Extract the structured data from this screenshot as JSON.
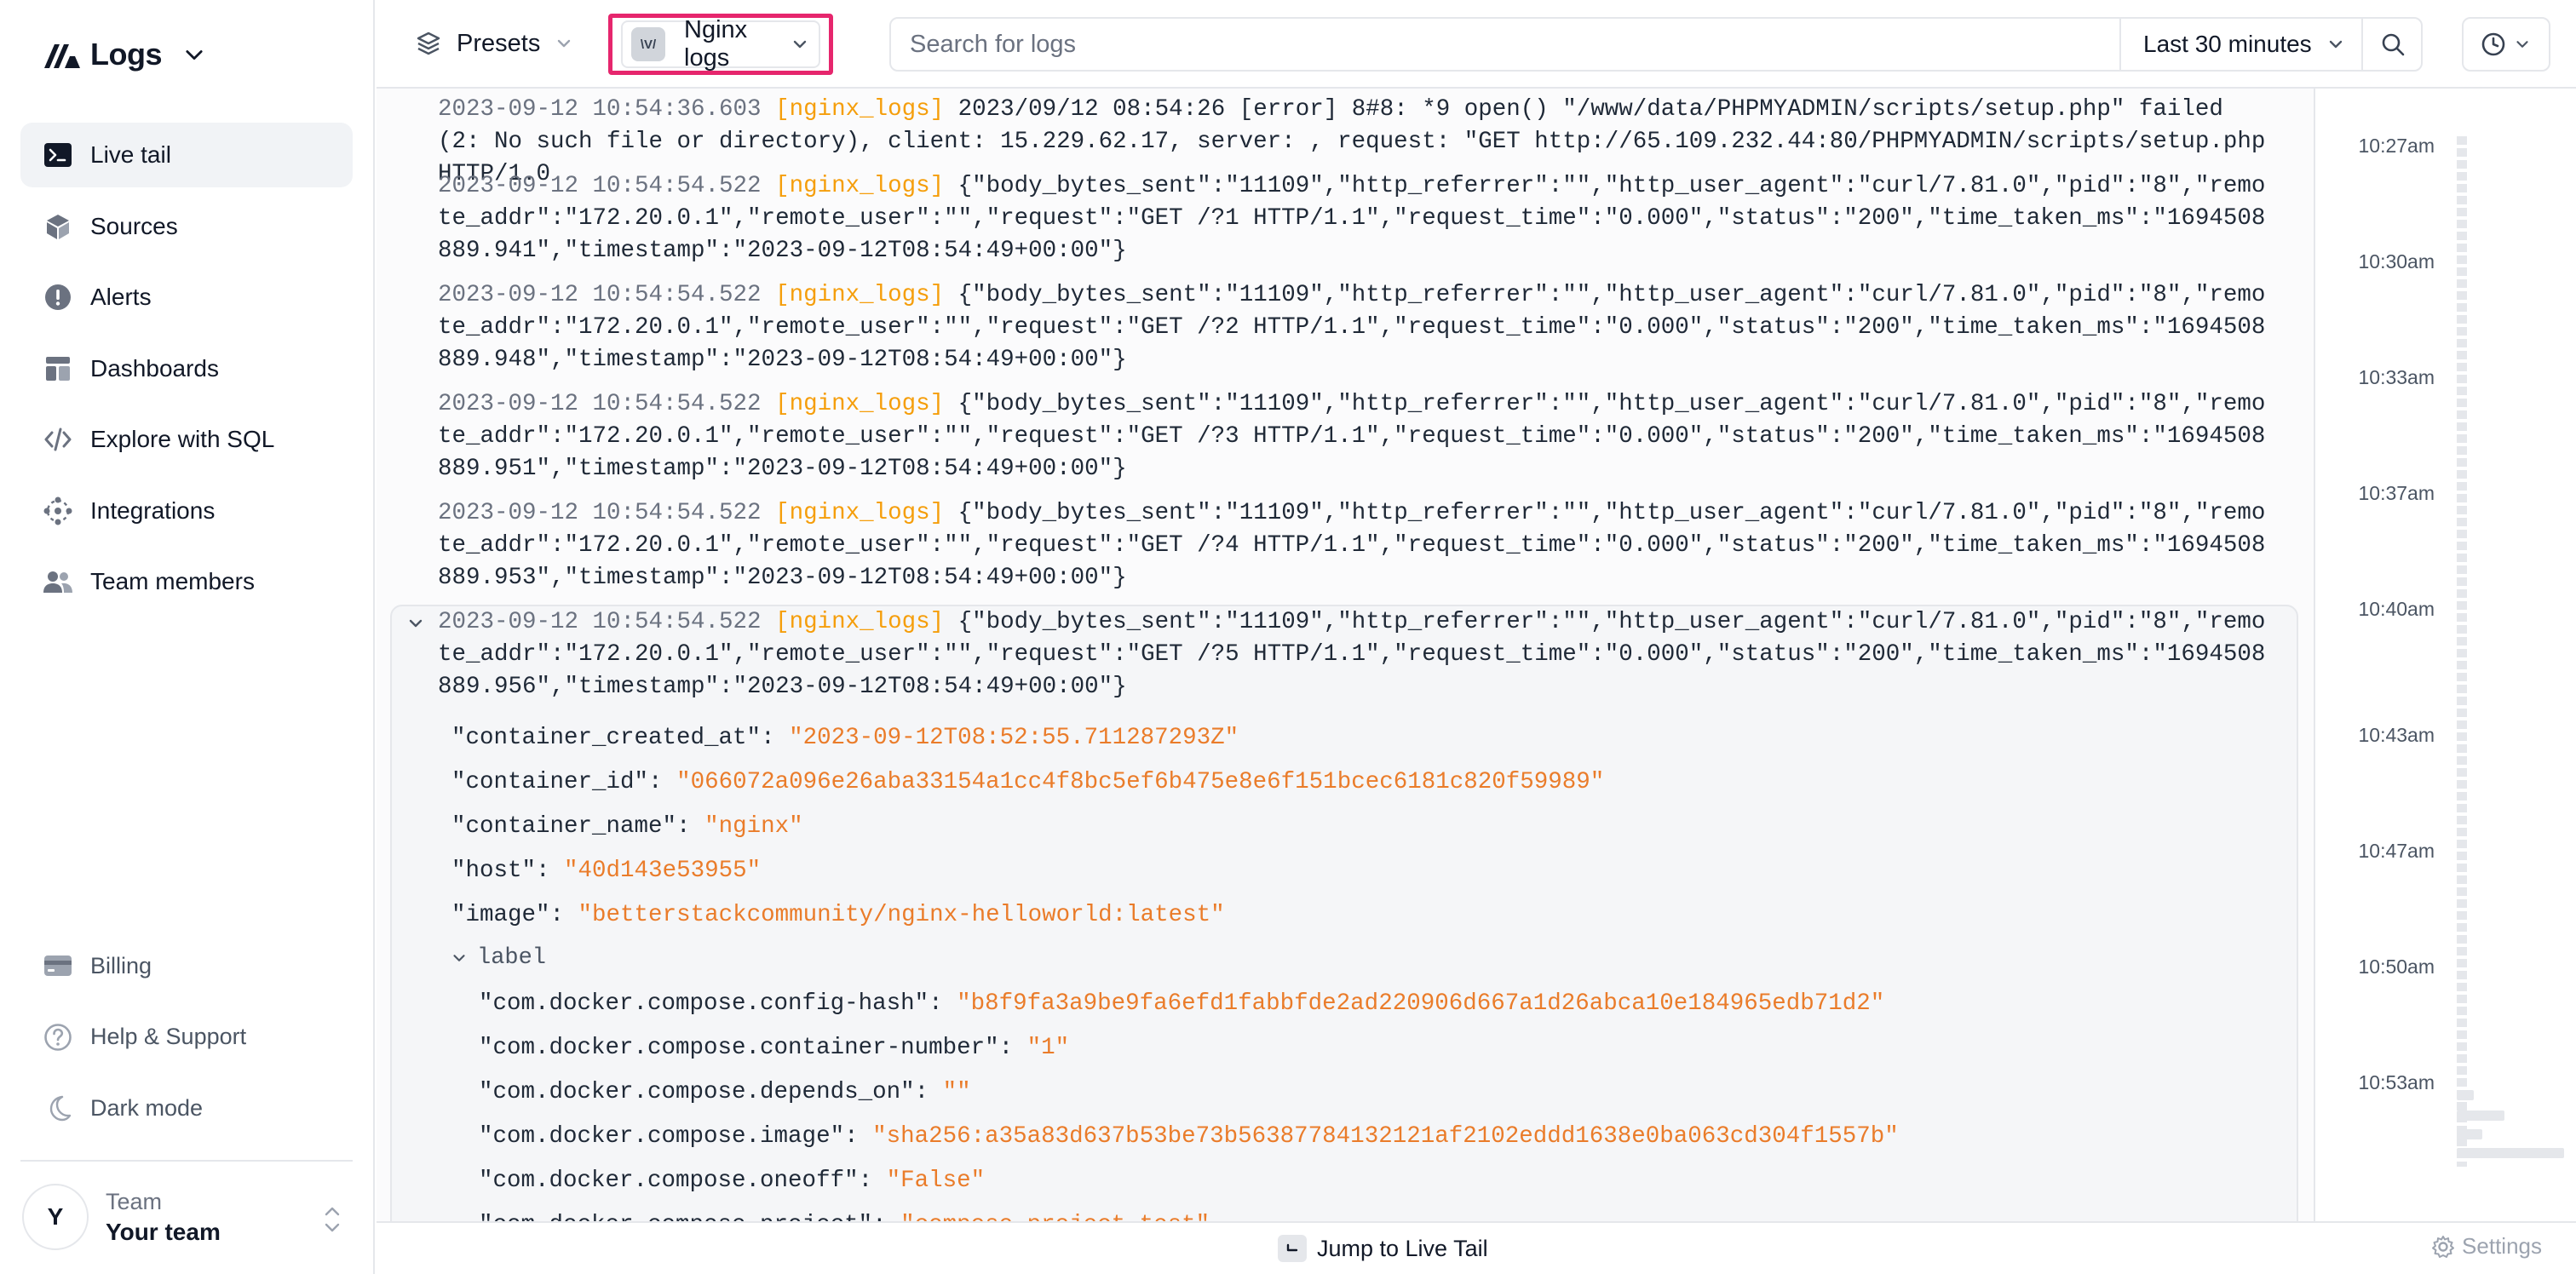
{
  "app": {
    "name": "Logs"
  },
  "sidebar": {
    "items": [
      {
        "label": "Live tail",
        "icon": "terminal-icon",
        "active": true
      },
      {
        "label": "Sources",
        "icon": "cube-icon"
      },
      {
        "label": "Alerts",
        "icon": "alert-icon"
      },
      {
        "label": "Dashboards",
        "icon": "dashboard-icon"
      },
      {
        "label": "Explore with SQL",
        "icon": "code-icon"
      },
      {
        "label": "Integrations",
        "icon": "integrations-icon"
      },
      {
        "label": "Team members",
        "icon": "users-icon"
      }
    ],
    "bottom_items": [
      {
        "label": "Billing",
        "icon": "card-icon"
      },
      {
        "label": "Help & Support",
        "icon": "help-icon"
      },
      {
        "label": "Dark mode",
        "icon": "moon-icon"
      }
    ],
    "team": {
      "avatar": "Y",
      "label": "Team",
      "name": "Your team"
    }
  },
  "toolbar": {
    "presets_label": "Presets",
    "source_badge": "\\V/",
    "source_label": "Nginx logs",
    "search_placeholder": "Search for logs",
    "time_range": "Last 30 minutes"
  },
  "colors": {
    "accent": "#e6266d",
    "source_tag": "#f59e0b",
    "value": "#ea7c2a"
  },
  "logs": [
    {
      "ts": "2023-09-12 10:54:36.603",
      "source": "[nginx_logs]",
      "msg": "2023/09/12 08:54:26 [error] 8#8: *9 open() \"/www/data/PHPMYADMIN/scripts/setup.php\" failed (2: No such file or directory), client: 15.229.62.17, server: , request: \"GET http://65.109.232.44:80/PHPMYADMIN/scripts/setup.php HTTP/1.0"
    },
    {
      "ts": "2023-09-12 10:54:54.522",
      "source": "[nginx_logs]",
      "msg": "{\"body_bytes_sent\":\"11109\",\"http_referrer\":\"\",\"http_user_agent\":\"curl/7.81.0\",\"pid\":\"8\",\"remote_addr\":\"172.20.0.1\",\"remote_user\":\"\",\"request\":\"GET /?1 HTTP/1.1\",\"request_time\":\"0.000\",\"status\":\"200\",\"time_taken_ms\":\"1694508889.941\",\"timestamp\":\"2023-09-12T08:54:49+00:00\"}"
    },
    {
      "ts": "2023-09-12 10:54:54.522",
      "source": "[nginx_logs]",
      "msg": "{\"body_bytes_sent\":\"11109\",\"http_referrer\":\"\",\"http_user_agent\":\"curl/7.81.0\",\"pid\":\"8\",\"remote_addr\":\"172.20.0.1\",\"remote_user\":\"\",\"request\":\"GET /?2 HTTP/1.1\",\"request_time\":\"0.000\",\"status\":\"200\",\"time_taken_ms\":\"1694508889.948\",\"timestamp\":\"2023-09-12T08:54:49+00:00\"}"
    },
    {
      "ts": "2023-09-12 10:54:54.522",
      "source": "[nginx_logs]",
      "msg": "{\"body_bytes_sent\":\"11109\",\"http_referrer\":\"\",\"http_user_agent\":\"curl/7.81.0\",\"pid\":\"8\",\"remote_addr\":\"172.20.0.1\",\"remote_user\":\"\",\"request\":\"GET /?3 HTTP/1.1\",\"request_time\":\"0.000\",\"status\":\"200\",\"time_taken_ms\":\"1694508889.951\",\"timestamp\":\"2023-09-12T08:54:49+00:00\"}"
    },
    {
      "ts": "2023-09-12 10:54:54.522",
      "source": "[nginx_logs]",
      "msg": "{\"body_bytes_sent\":\"11109\",\"http_referrer\":\"\",\"http_user_agent\":\"curl/7.81.0\",\"pid\":\"8\",\"remote_addr\":\"172.20.0.1\",\"remote_user\":\"\",\"request\":\"GET /?4 HTTP/1.1\",\"request_time\":\"0.000\",\"status\":\"200\",\"time_taken_ms\":\"1694508889.953\",\"timestamp\":\"2023-09-12T08:54:49+00:00\"}"
    },
    {
      "ts": "2023-09-12 10:54:54.522",
      "source": "[nginx_logs]",
      "msg": "{\"body_bytes_sent\":\"11109\",\"http_referrer\":\"\",\"http_user_agent\":\"curl/7.81.0\",\"pid\":\"8\",\"remote_addr\":\"172.20.0.1\",\"remote_user\":\"\",\"request\":\"GET /?5 HTTP/1.1\",\"request_time\":\"0.000\",\"status\":\"200\",\"time_taken_ms\":\"1694508889.956\",\"timestamp\":\"2023-09-12T08:54:49+00:00\"}"
    }
  ],
  "expanded": {
    "fields": [
      {
        "key": "\"container_created_at\"",
        "value": "\"2023-09-12T08:52:55.711287293Z\""
      },
      {
        "key": "\"container_id\"",
        "value": "\"066072a096e26aba33154a1cc4f8bc5ef6b475e8e6f151bcec6181c820f59989\""
      },
      {
        "key": "\"container_name\"",
        "value": "\"nginx\""
      },
      {
        "key": "\"host\"",
        "value": "\"40d143e53955\""
      },
      {
        "key": "\"image\"",
        "value": "\"betterstackcommunity/nginx-helloworld:latest\""
      }
    ],
    "label_group": "label",
    "label_fields": [
      {
        "key": "\"com.docker.compose.config-hash\"",
        "value": "\"b8f9fa3a9be9fa6efd1fabbfde2ad220906d667a1d26abca10e184965edb71d2\""
      },
      {
        "key": "\"com.docker.compose.container-number\"",
        "value": "\"1\""
      },
      {
        "key": "\"com.docker.compose.depends_on\"",
        "value": "\"\""
      },
      {
        "key": "\"com.docker.compose.image\"",
        "value": "\"sha256:a35a83d637b53be73b56387784132121af2102eddd1638e0ba063cd304f1557b\""
      },
      {
        "key": "\"com.docker.compose.oneoff\"",
        "value": "\"False\""
      },
      {
        "key": "\"com.docker.compose.project\"",
        "value": "\"compose-project-test\""
      }
    ]
  },
  "timeline": {
    "labels": [
      "10:27am",
      "10:30am",
      "10:33am",
      "10:37am",
      "10:40am",
      "10:43am",
      "10:47am",
      "10:50am",
      "10:53am"
    ]
  },
  "bottombar": {
    "jump_label": "Jump to Live Tail",
    "settings_label": "Settings"
  }
}
